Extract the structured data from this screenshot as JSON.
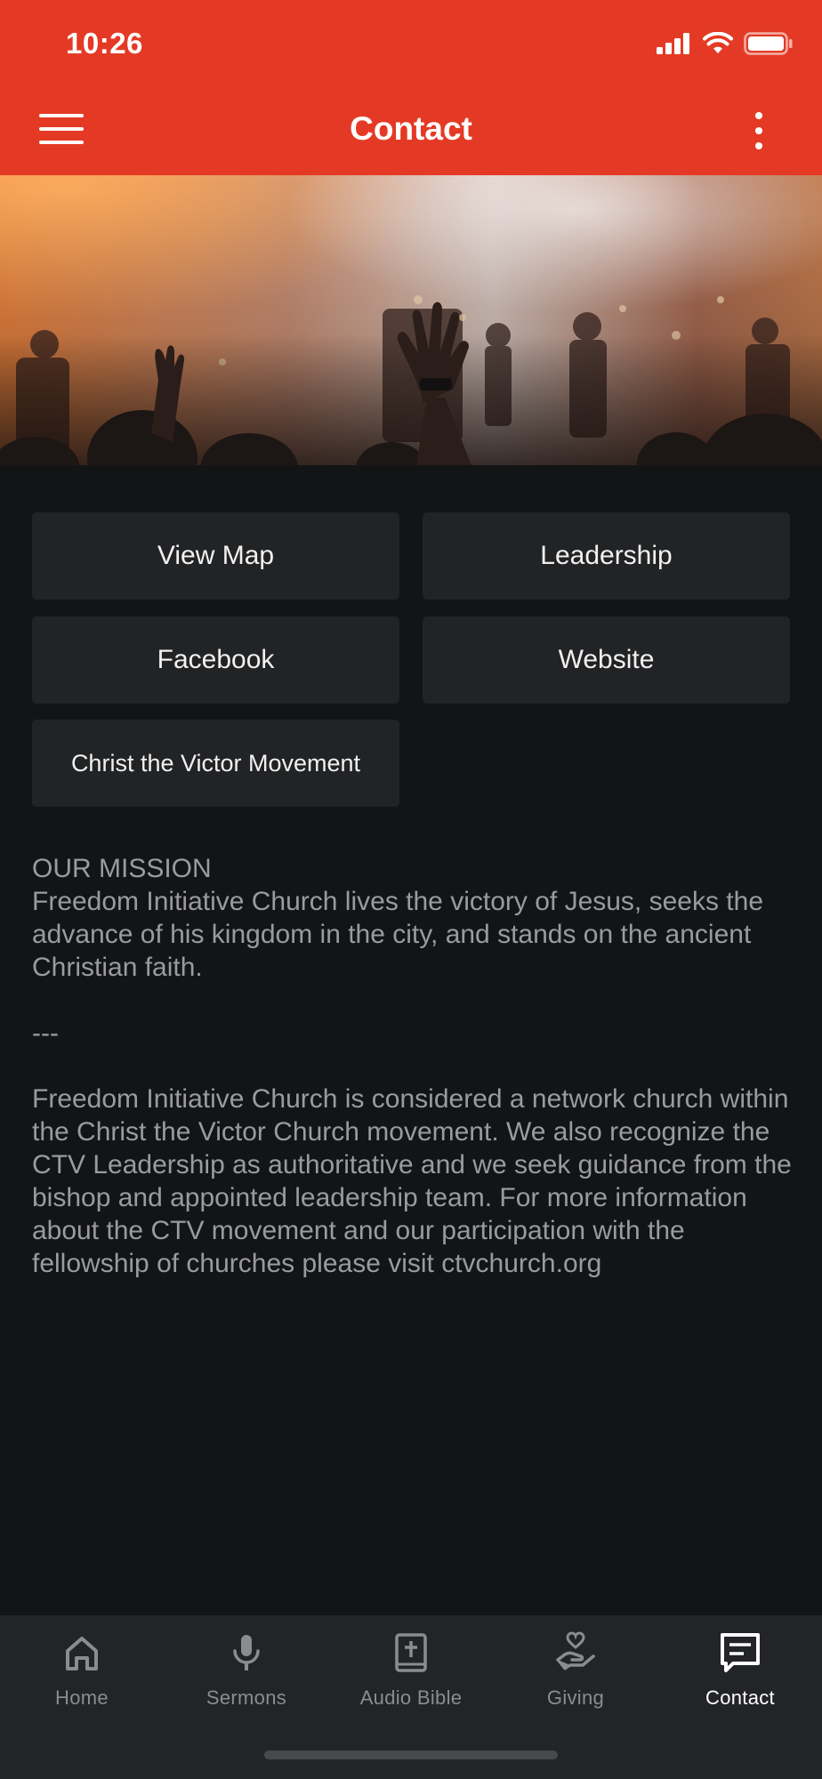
{
  "status_bar": {
    "time": "10:26"
  },
  "nav": {
    "title": "Contact"
  },
  "buttons": {
    "view_map": "View Map",
    "leadership": "Leadership",
    "facebook": "Facebook",
    "website": "Website",
    "ctv_movement": "Christ the Victor Movement"
  },
  "mission": {
    "heading": "OUR MISSION",
    "statement": "Freedom Initiative Church lives the victory of Jesus, seeks the advance of his kingdom in the city, and stands on the ancient Christian faith.",
    "divider": "---",
    "network": "Freedom Initiative Church is considered a network church within the Christ the Victor Church movement. We also recognize the CTV Leadership as authoritative and we seek guidance from the bishop and appointed leadership team. For more information about the CTV movement and our participation with the fellowship of churches please visit ctvchurch.org"
  },
  "tabs": [
    {
      "label": "Home",
      "icon": "home-icon"
    },
    {
      "label": "Sermons",
      "icon": "microphone-icon"
    },
    {
      "label": "Audio Bible",
      "icon": "bible-icon"
    },
    {
      "label": "Giving",
      "icon": "giving-hand-icon"
    },
    {
      "label": "Contact",
      "icon": "message-icon",
      "active": true
    }
  ],
  "colors": {
    "brand": "#e43a25",
    "background": "#131416",
    "button": "#222325",
    "tabbar": "#232427",
    "body_text": "#9a9b9e",
    "inactive_tab": "#8b8c8f"
  }
}
